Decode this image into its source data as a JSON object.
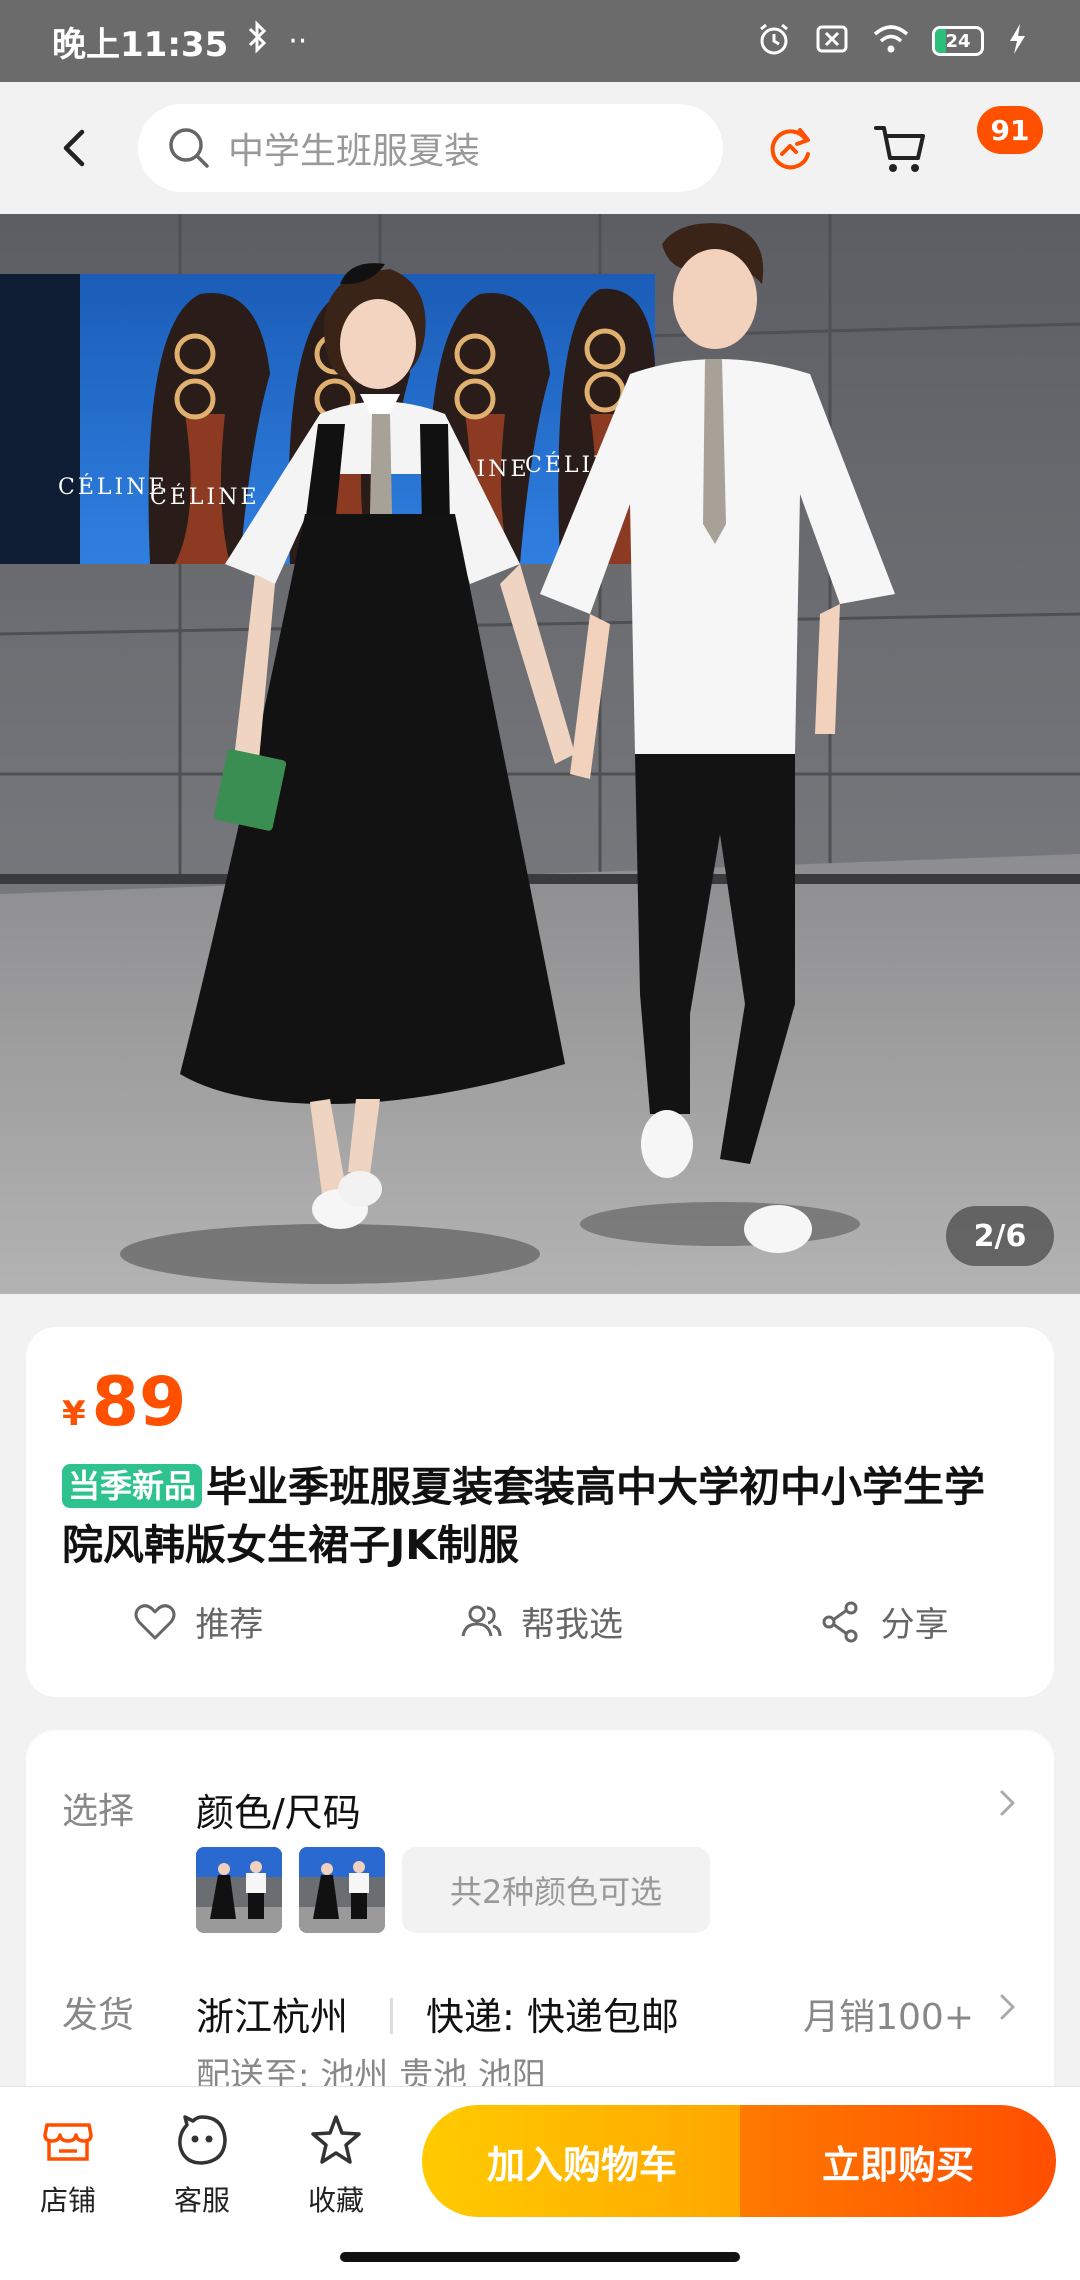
{
  "status_bar": {
    "time": "晚上11:35",
    "bluetooth_icon": "bluetooth-icon",
    "more": "··",
    "battery_level": "24",
    "battery_fraction": 0.24
  },
  "header": {
    "search_placeholder": "中学生班服夏装",
    "cart_badge": "91"
  },
  "gallery": {
    "counter": "2/6",
    "poster_brand": "CÉLINE"
  },
  "product": {
    "currency": "¥",
    "price": "89",
    "tag": "当季新品",
    "title": "毕业季班服夏装套装高中大学初中小学生学院风韩版女生裙子JK制服",
    "actions": {
      "recommend": "推荐",
      "help_choose": "帮我选",
      "share": "分享"
    }
  },
  "options": {
    "select_label": "选择",
    "select_value": "颜色/尺码",
    "color_count": "共2种颜色可选",
    "ship_label": "发货",
    "ship_from": "浙江杭州",
    "express": "快递: 快递包邮",
    "monthly_sales": "月销100+",
    "deliver_to": "配送至: 池州 贵池 池阳"
  },
  "bottom_bar": {
    "store": "店铺",
    "service": "客服",
    "favorite": "收藏",
    "add_to_cart": "加入购物车",
    "buy_now": "立即购买"
  },
  "colors": {
    "accent": "#ff5000",
    "cart_button": "#ffb400",
    "new_tag": "#2ec28e"
  }
}
